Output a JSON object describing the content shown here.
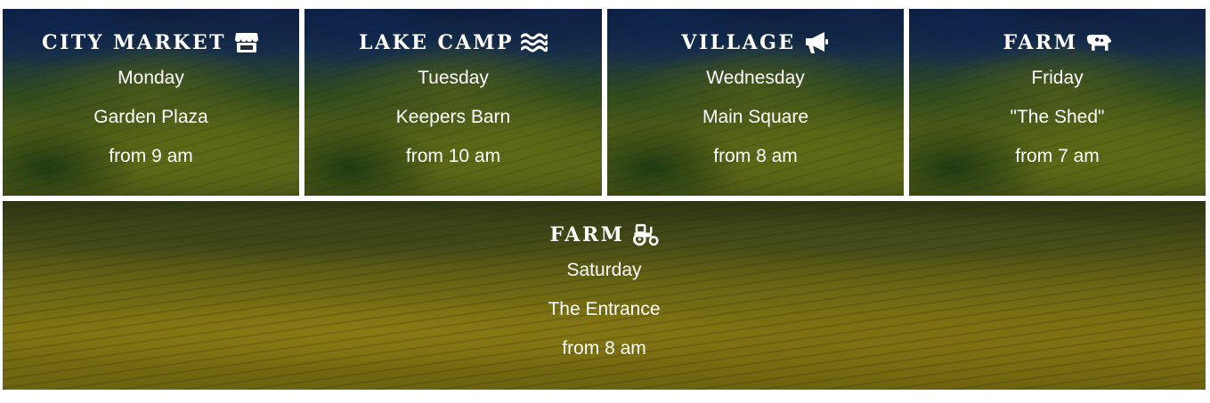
{
  "markets": [
    {
      "title": "City Market",
      "icon": "store-icon",
      "day": "Monday",
      "location": "Garden Plaza",
      "time": "from 9 am"
    },
    {
      "title": "Lake Camp",
      "icon": "water-icon",
      "day": "Tuesday",
      "location": "Keepers Barn",
      "time": "from 10 am"
    },
    {
      "title": "Village",
      "icon": "megaphone-icon",
      "day": "Wednesday",
      "location": "Main Square",
      "time": "from 8 am"
    },
    {
      "title": "Farm",
      "icon": "cow-icon",
      "day": "Friday",
      "location": "\"The Shed\"",
      "time": "from 7 am"
    },
    {
      "title": "Farm",
      "icon": "tractor-icon",
      "day": "Saturday",
      "location": "The Entrance",
      "time": "from 8 am"
    }
  ],
  "colors": {
    "text": "#ffffff",
    "page_background": "#ffffff"
  }
}
